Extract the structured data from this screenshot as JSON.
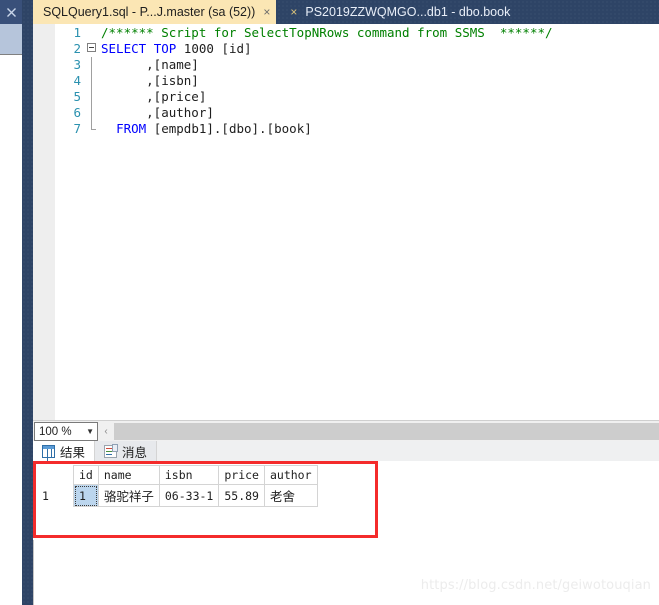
{
  "window": {
    "close_icon": "close-icon"
  },
  "tabs": [
    {
      "label": "SQLQuery1.sql - P...J.master (sa (52))",
      "active": true,
      "close": "×"
    },
    {
      "label": "PS2019ZZWQMGO...db1 - dbo.book",
      "active": false,
      "close": "×"
    }
  ],
  "editor": {
    "lines": [
      {
        "num": "1",
        "fold": "none",
        "text": "/****** Script for SelectTopNRows command from SSMS  ******/",
        "style": "comment"
      },
      {
        "num": "2",
        "fold": "box",
        "text": "SELECT TOP 1000 [id]",
        "style": "code"
      },
      {
        "num": "3",
        "fold": "bar",
        "text": "      ,[name]",
        "style": "code"
      },
      {
        "num": "4",
        "fold": "bar",
        "text": "      ,[isbn]",
        "style": "code"
      },
      {
        "num": "5",
        "fold": "bar",
        "text": "      ,[price]",
        "style": "code"
      },
      {
        "num": "6",
        "fold": "bar",
        "text": "      ,[author]",
        "style": "code"
      },
      {
        "num": "7",
        "fold": "barend",
        "text": "  FROM [empdb1].[dbo].[book]",
        "style": "code"
      }
    ],
    "keywords": [
      "SELECT",
      "TOP",
      "FROM"
    ],
    "comment_color": "#008000",
    "keyword_color": "#0000ff",
    "linenum_color": "#2b91af"
  },
  "zoombar": {
    "zoom_level": "100 %",
    "caret": "▼",
    "scroll_left": "‹"
  },
  "result_tabs": [
    {
      "label": "结果",
      "icon": "grid-icon",
      "active": true
    },
    {
      "label": "消息",
      "icon": "message-icon",
      "active": false
    }
  ],
  "grid": {
    "columns": [
      "id",
      "name",
      "isbn",
      "price",
      "author"
    ],
    "rows": [
      {
        "row_number": "1",
        "id": "1",
        "name": "骆驼祥子",
        "isbn": "06-33-1",
        "price": "55.89",
        "author": "老舍"
      }
    ],
    "selected_cell": {
      "row": 0,
      "column": "id",
      "value": "1"
    },
    "highlight_color": "#f42b2b",
    "selection_color": "#bcd6ee"
  },
  "watermark": {
    "text": "https://blog.csdn.net/geiwotouqian"
  }
}
